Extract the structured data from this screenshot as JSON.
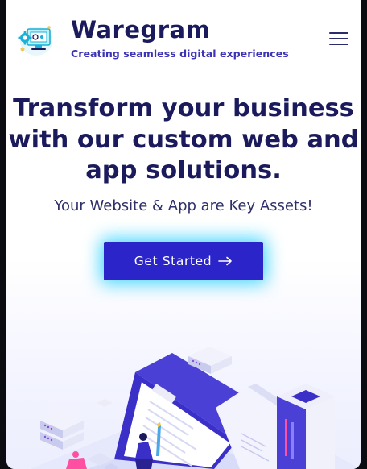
{
  "brand": {
    "name": "Waregram",
    "tagline": "Creating seamless digital experiences",
    "logo_icon": "gear-monitor-logo"
  },
  "header": {
    "menu_icon": "hamburger-menu-icon"
  },
  "hero": {
    "title": "Transform your business with our custom web and app solutions.",
    "subtitle": "Your Website & App are Key Assets!",
    "cta_label": "Get Started",
    "cta_icon": "arrow-right-icon"
  },
  "colors": {
    "primary": "#2b24c9",
    "heading": "#1a1a5c",
    "tagline": "#3c34b4",
    "glow": "#00c8ff"
  }
}
